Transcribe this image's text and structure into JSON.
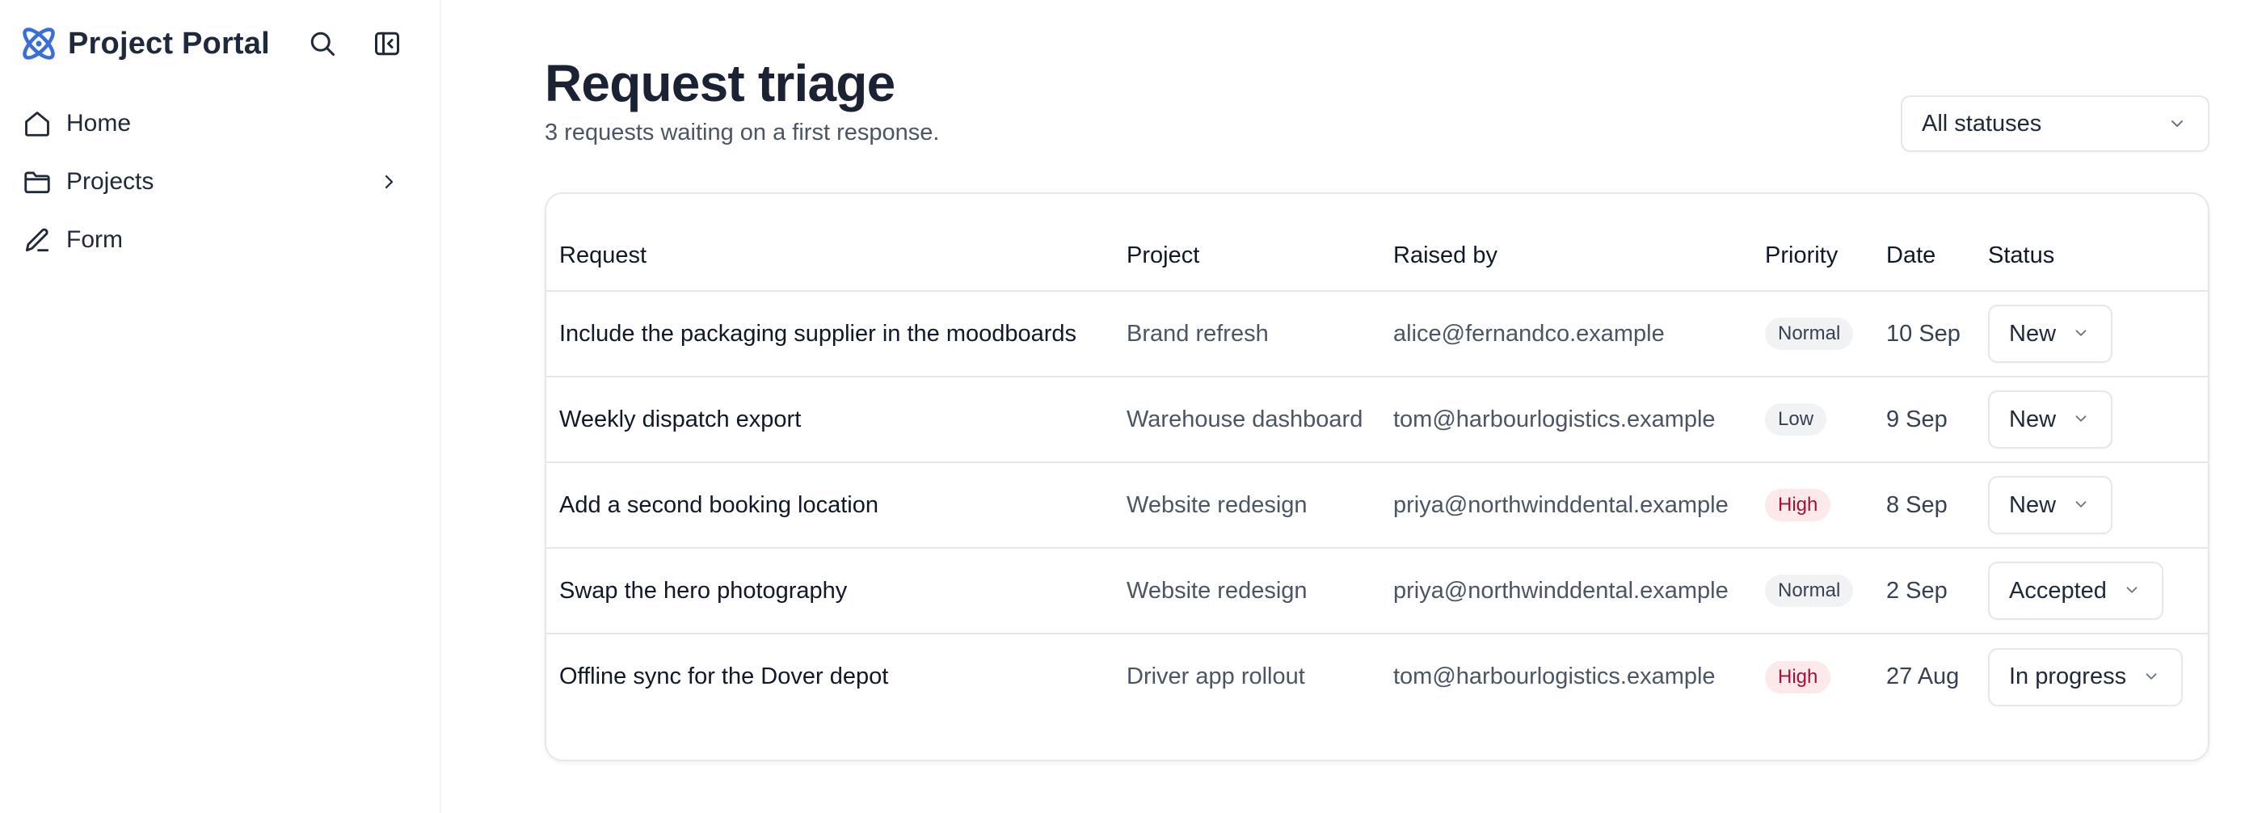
{
  "app": {
    "name": "Project Portal"
  },
  "sidebar": {
    "items": [
      {
        "label": "Home",
        "icon": "home-icon"
      },
      {
        "label": "Projects",
        "icon": "folder-icon",
        "has_children": true
      },
      {
        "label": "Form",
        "icon": "pen-icon"
      }
    ]
  },
  "page": {
    "title": "Request triage",
    "subtitle": "3 requests waiting on a first response.",
    "filter": {
      "selected": "All statuses"
    }
  },
  "table": {
    "columns": [
      "Request",
      "Project",
      "Raised by",
      "Priority",
      "Date",
      "Status"
    ],
    "rows": [
      {
        "request": "Include the packaging supplier in the moodboards",
        "project": "Brand refresh",
        "raised_by": "alice@fernandco.example",
        "priority": "Normal",
        "date": "10 Sep",
        "status": "New"
      },
      {
        "request": "Weekly dispatch export",
        "project": "Warehouse dashboard",
        "raised_by": "tom@harbourlogistics.example",
        "priority": "Low",
        "date": "9 Sep",
        "status": "New"
      },
      {
        "request": "Add a second booking location",
        "project": "Website redesign",
        "raised_by": "priya@northwinddental.example",
        "priority": "High",
        "date": "8 Sep",
        "status": "New"
      },
      {
        "request": "Swap the hero photography",
        "project": "Website redesign",
        "raised_by": "priya@northwinddental.example",
        "priority": "Normal",
        "date": "2 Sep",
        "status": "Accepted"
      },
      {
        "request": "Offline sync for the Dover depot",
        "project": "Driver app rollout",
        "raised_by": "tom@harbourlogistics.example",
        "priority": "High",
        "date": "27 Aug",
        "status": "In progress"
      }
    ]
  },
  "colors": {
    "accent": "#3b6fd8",
    "high_bg": "#fde8ea",
    "high_text": "#9f1239",
    "neutral_bg": "#f1f2f4"
  }
}
